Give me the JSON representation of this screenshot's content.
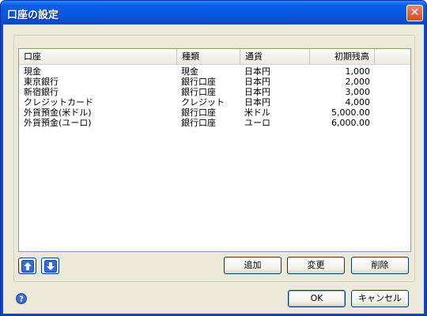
{
  "window": {
    "title": "口座の設定",
    "close_glyph": "✕"
  },
  "table": {
    "columns": [
      "口座",
      "種類",
      "通貨",
      "初期残高"
    ],
    "rows": [
      {
        "name": "現金",
        "type": "現金",
        "currency": "日本円",
        "balance": "1,000"
      },
      {
        "name": "東京銀行",
        "type": "銀行口座",
        "currency": "日本円",
        "balance": "2,000"
      },
      {
        "name": "新宿銀行",
        "type": "銀行口座",
        "currency": "日本円",
        "balance": "3,000"
      },
      {
        "name": "クレジットカード",
        "type": "クレジット",
        "currency": "日本円",
        "balance": "4,000"
      },
      {
        "name": "外貨預金(米ドル)",
        "type": "銀行口座",
        "currency": "米ドル",
        "balance": "5,000.00"
      },
      {
        "name": "外貨預金(ユーロ)",
        "type": "銀行口座",
        "currency": "ユーロ",
        "balance": "6,000.00"
      }
    ]
  },
  "buttons": {
    "move_up_icon": "arrow-up-icon",
    "move_down_icon": "arrow-down-icon",
    "add": "追加",
    "edit": "変更",
    "delete": "削除",
    "ok": "OK",
    "cancel": "キャンセル"
  },
  "colors": {
    "titlebar": "#0a57e0",
    "dialog": "#ece9d8",
    "icon_blue": "#2f6fd6"
  }
}
